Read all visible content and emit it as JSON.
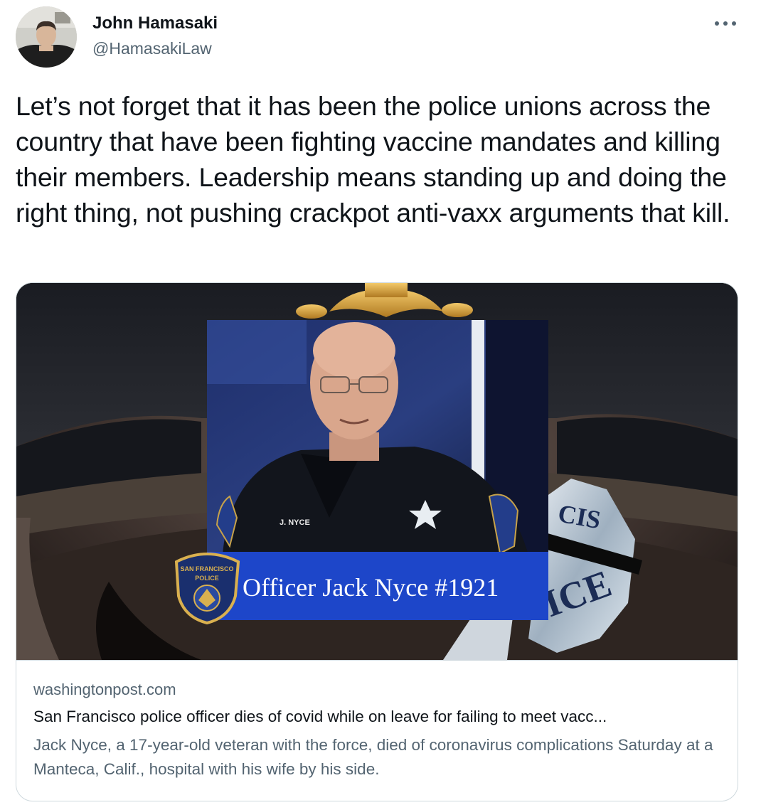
{
  "author": {
    "display_name": "John Hamasaki",
    "handle": "@HamasakiLaw",
    "avatar_icon": "person-avatar"
  },
  "more_icon": "more-horizontal-icon",
  "tweet": {
    "text": "Let’s not forget that it has been the police unions across the country that have been fighting vaccine mandates and killing their members. Leadership means standing up and doing the right thing, not pushing crackpot anti-vaxx arguments that kill."
  },
  "card": {
    "image": {
      "caption": "Officer Jack Nyce #1921",
      "patch_line1": "SAN FRANCISCO",
      "patch_line2": "POLICE",
      "name_tag": "J. NYCE",
      "badge_letters": "ICE"
    },
    "domain": "washingtonpost.com",
    "title": "San Francisco police officer dies of covid while on leave for failing to meet vacc...",
    "description": "Jack Nyce, a 17-year-old veteran with the force, died of coronavirus complications Saturday at a Manteca, Calif., hospital with his wife by his side."
  },
  "colors": {
    "text_primary": "#0f1419",
    "text_secondary": "#536471",
    "border": "#cfd9de",
    "banner_blue": "#1d46c9"
  }
}
